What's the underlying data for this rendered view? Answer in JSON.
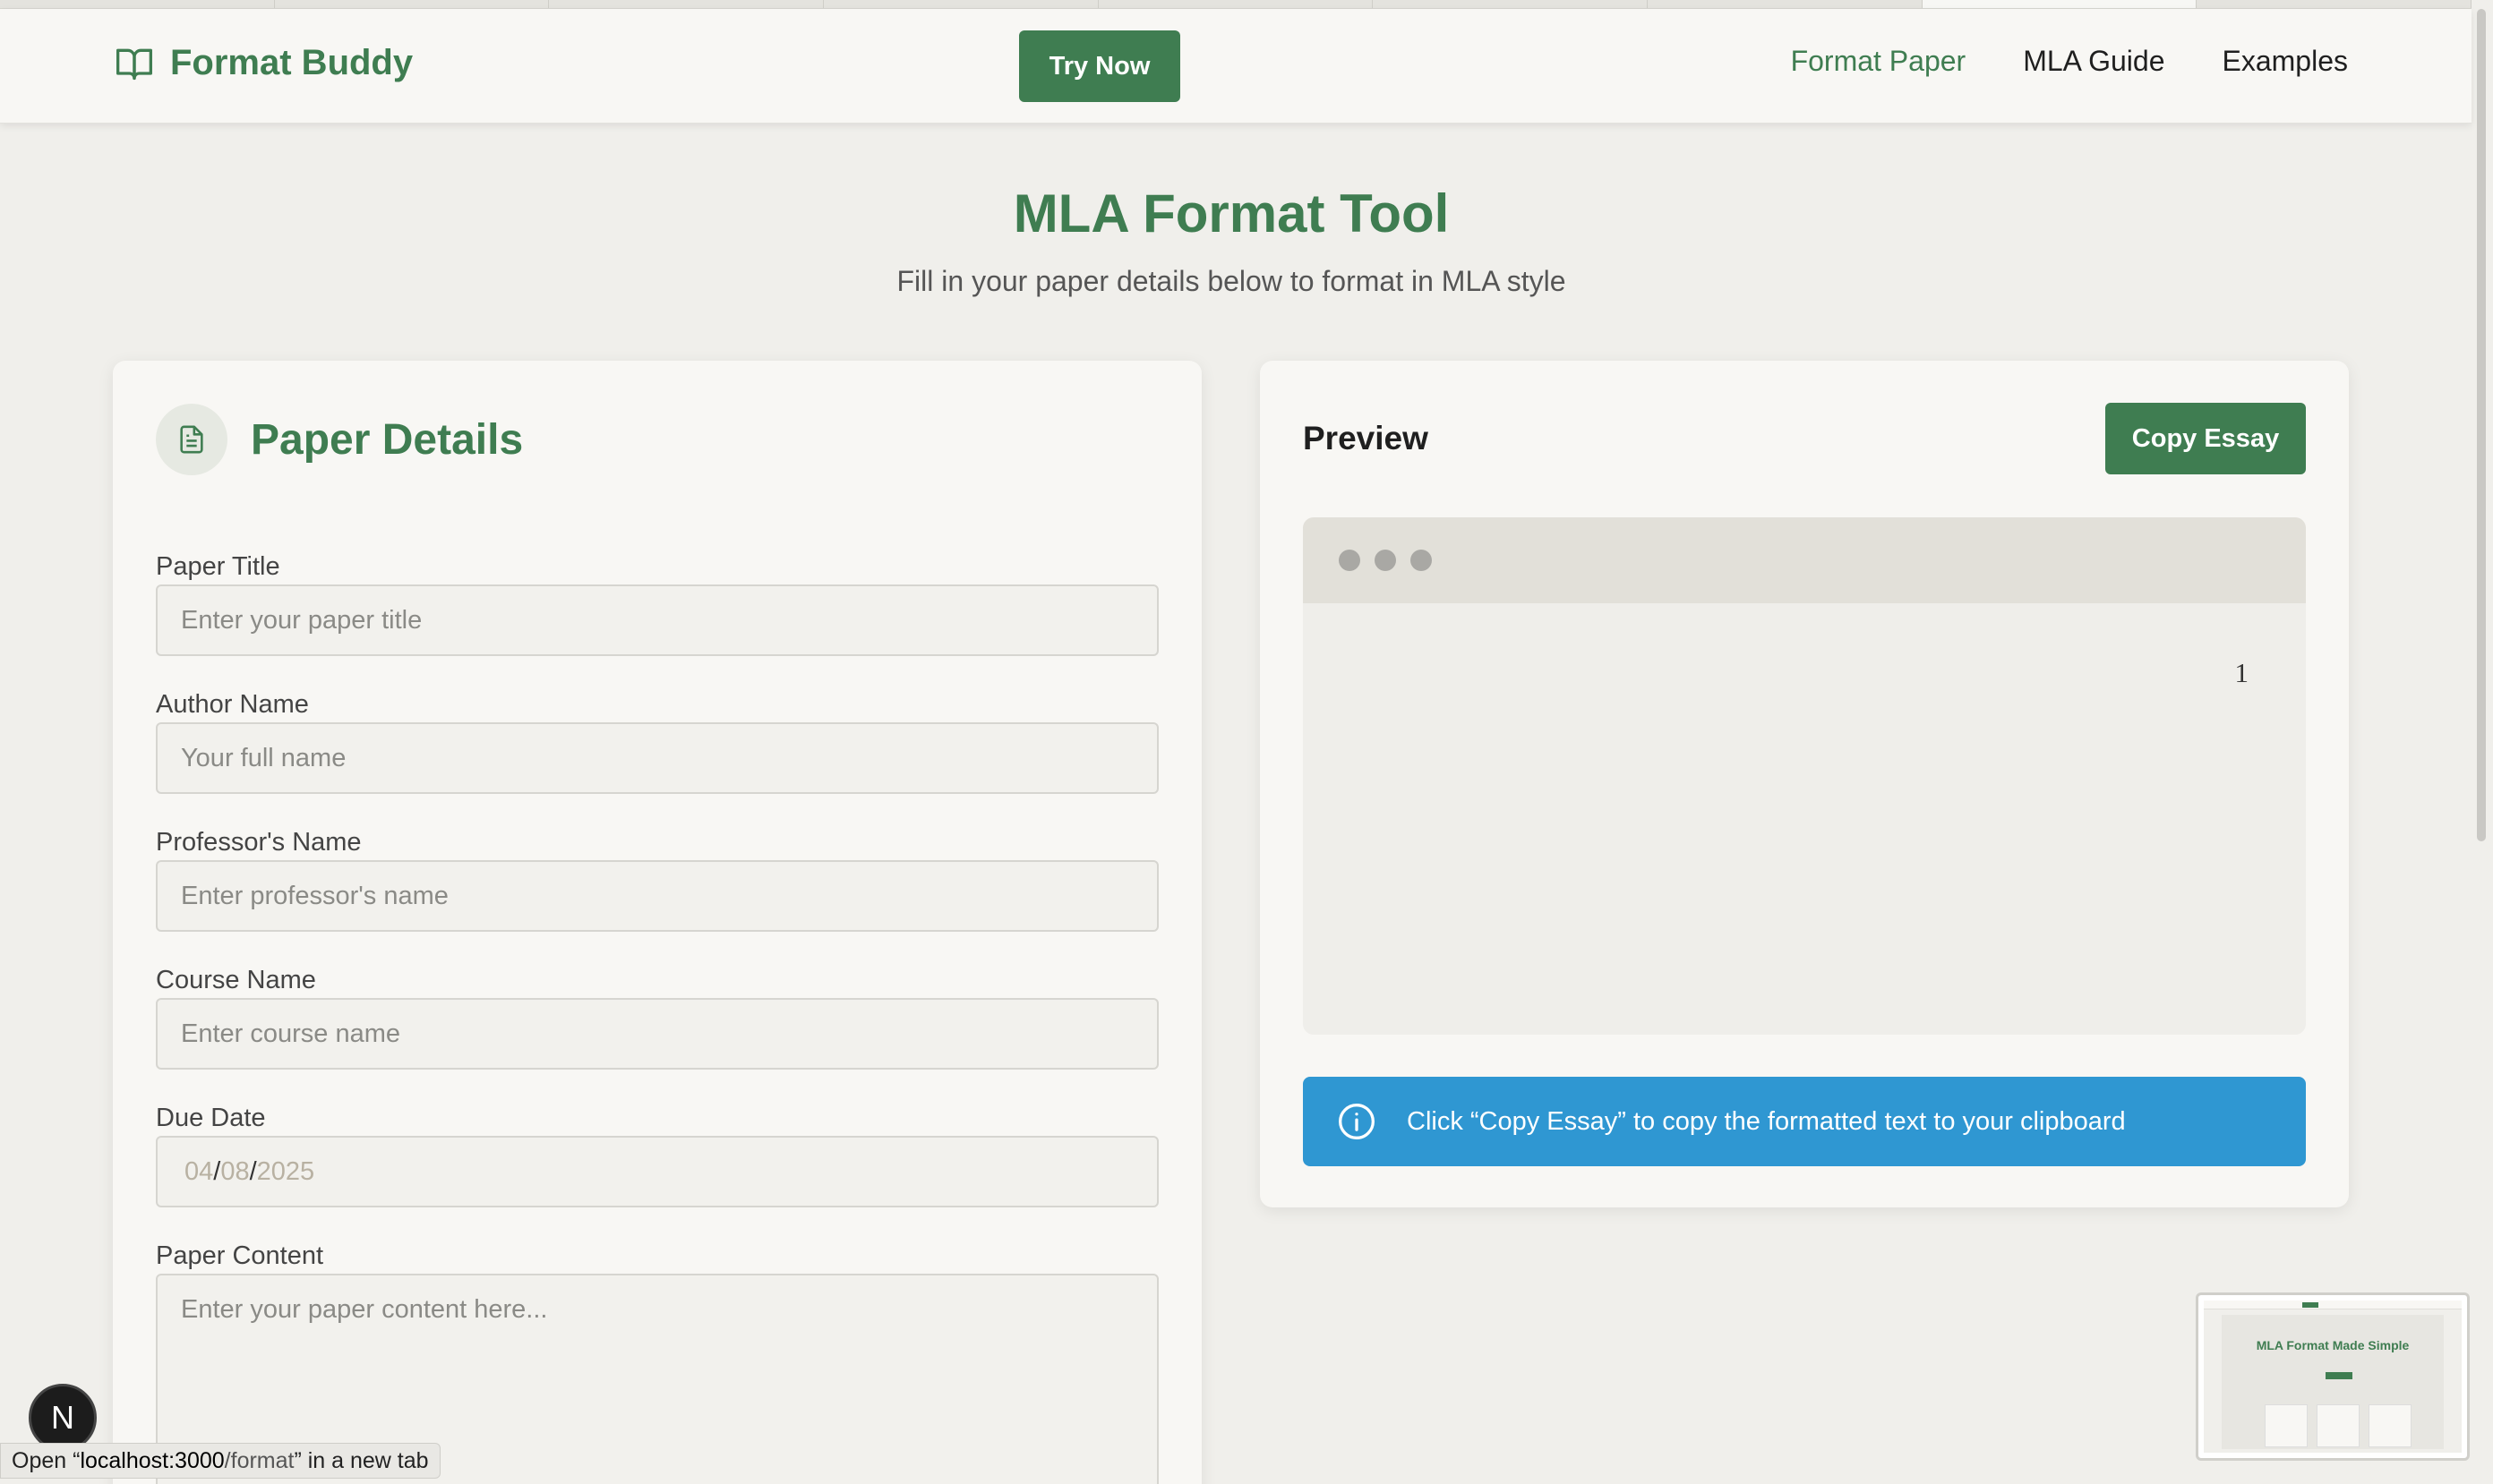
{
  "header": {
    "brand": "Format Buddy",
    "try_now": "Try Now",
    "nav": [
      {
        "label": "Format Paper",
        "active": true
      },
      {
        "label": "MLA Guide",
        "active": false
      },
      {
        "label": "Examples",
        "active": false
      }
    ]
  },
  "hero": {
    "title": "MLA Format Tool",
    "subtitle": "Fill in your paper details below to format in MLA style"
  },
  "details": {
    "title": "Paper Details",
    "fields": {
      "title": {
        "label": "Paper Title",
        "placeholder": "Enter your paper title"
      },
      "author": {
        "label": "Author Name",
        "placeholder": "Your full name"
      },
      "professor": {
        "label": "Professor's Name",
        "placeholder": "Enter professor's name"
      },
      "course": {
        "label": "Course Name",
        "placeholder": "Enter course name"
      },
      "due_date": {
        "label": "Due Date",
        "month": "04",
        "day": "08",
        "year": "2025",
        "separator": "/"
      },
      "content": {
        "label": "Paper Content",
        "placeholder": "Enter your paper content here..."
      }
    }
  },
  "preview": {
    "title": "Preview",
    "copy_button": "Copy Essay",
    "page_number": "1",
    "info": "Click “Copy Essay” to copy the formatted text to your clipboard"
  },
  "overlay": {
    "dev_badge": "N",
    "status_prefix": "Open “",
    "status_host": "localhost:3000",
    "status_path": "/format",
    "status_suffix": "” in a new tab",
    "thumbnail_title": "MLA Format Made Simple"
  },
  "colors": {
    "brand_green": "#3f7d51",
    "info_blue": "#2f97d2",
    "page_bg": "#f0efeb"
  },
  "icons": {
    "brand": "book-open-icon",
    "details": "document-icon",
    "info": "info-circle-icon"
  }
}
